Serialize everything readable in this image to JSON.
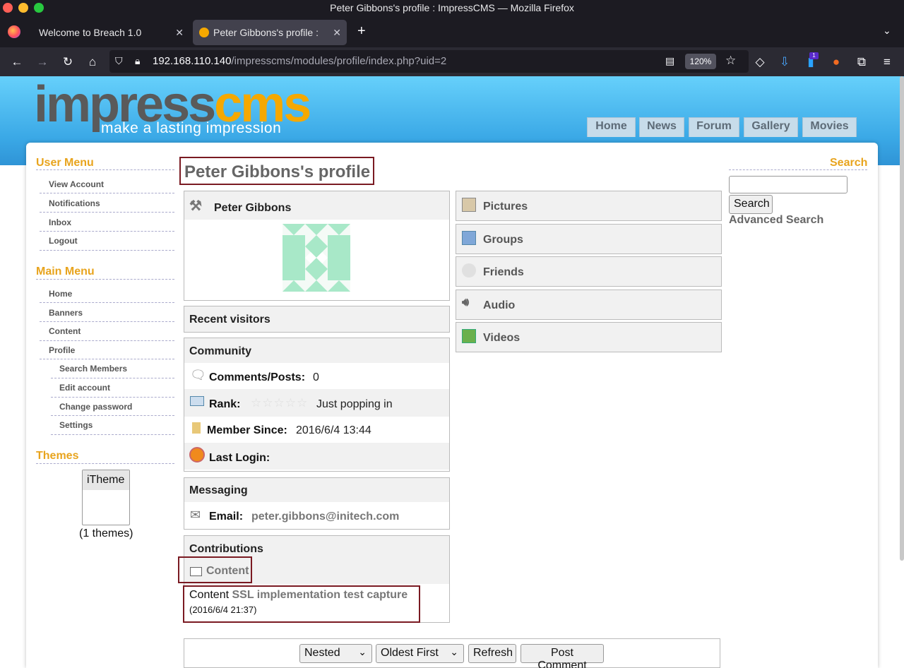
{
  "window": {
    "title": "Peter Gibbons's profile : ImpressCMS — Mozilla Firefox"
  },
  "tabs": [
    {
      "label": "Welcome to Breach 1.0",
      "active": false
    },
    {
      "label": "Peter Gibbons's profile : I",
      "active": true
    }
  ],
  "navbar": {
    "url_host": "192.168.110.140",
    "url_path": "/impresscms/modules/profile/index.php?uid=2",
    "zoom": "120%",
    "extension_badge": "1"
  },
  "site": {
    "logo_part1": "impress",
    "logo_part2": "cms",
    "tagline": "make a lasting impression",
    "topnav": [
      "Home",
      "News",
      "Forum",
      "Gallery",
      "Movies"
    ]
  },
  "sidebar": {
    "user_menu_title": "User Menu",
    "user_menu": [
      "View Account",
      "Notifications",
      "Inbox",
      "Logout"
    ],
    "main_menu_title": "Main Menu",
    "main_menu": [
      "Home",
      "Banners",
      "Content",
      "Profile"
    ],
    "profile_submenu": [
      "Search Members",
      "Edit account",
      "Change password",
      "Settings"
    ],
    "themes_title": "Themes",
    "theme_option": "iTheme",
    "themes_count": "(1 themes)"
  },
  "profile": {
    "page_title": "Peter Gibbons's profile",
    "user_name": "Peter Gibbons",
    "recent_visitors": "Recent visitors",
    "community_title": "Community",
    "comments_label": "Comments/Posts:",
    "comments_value": "0",
    "rank_label": "Rank:",
    "rank_value": "Just popping in",
    "member_since_label": "Member Since:",
    "member_since_value": "2016/6/4 13:44",
    "last_login_label": "Last Login:",
    "messaging_title": "Messaging",
    "email_label": "Email:",
    "email_value": "peter.gibbons@initech.com",
    "contributions_title": "Contributions",
    "content_link": "Content",
    "content_prefix": "Content",
    "content_item": "SSL implementation test capture",
    "content_date": "(2016/6/4 21:37)"
  },
  "right_panels": [
    "Pictures",
    "Groups",
    "Friends",
    "Audio",
    "Videos"
  ],
  "search": {
    "title": "Search",
    "button": "Search",
    "advanced": "Advanced Search"
  },
  "comments_bar": {
    "mode": "Nested",
    "order": "Oldest First",
    "refresh": "Refresh",
    "post": "Post Comment"
  }
}
